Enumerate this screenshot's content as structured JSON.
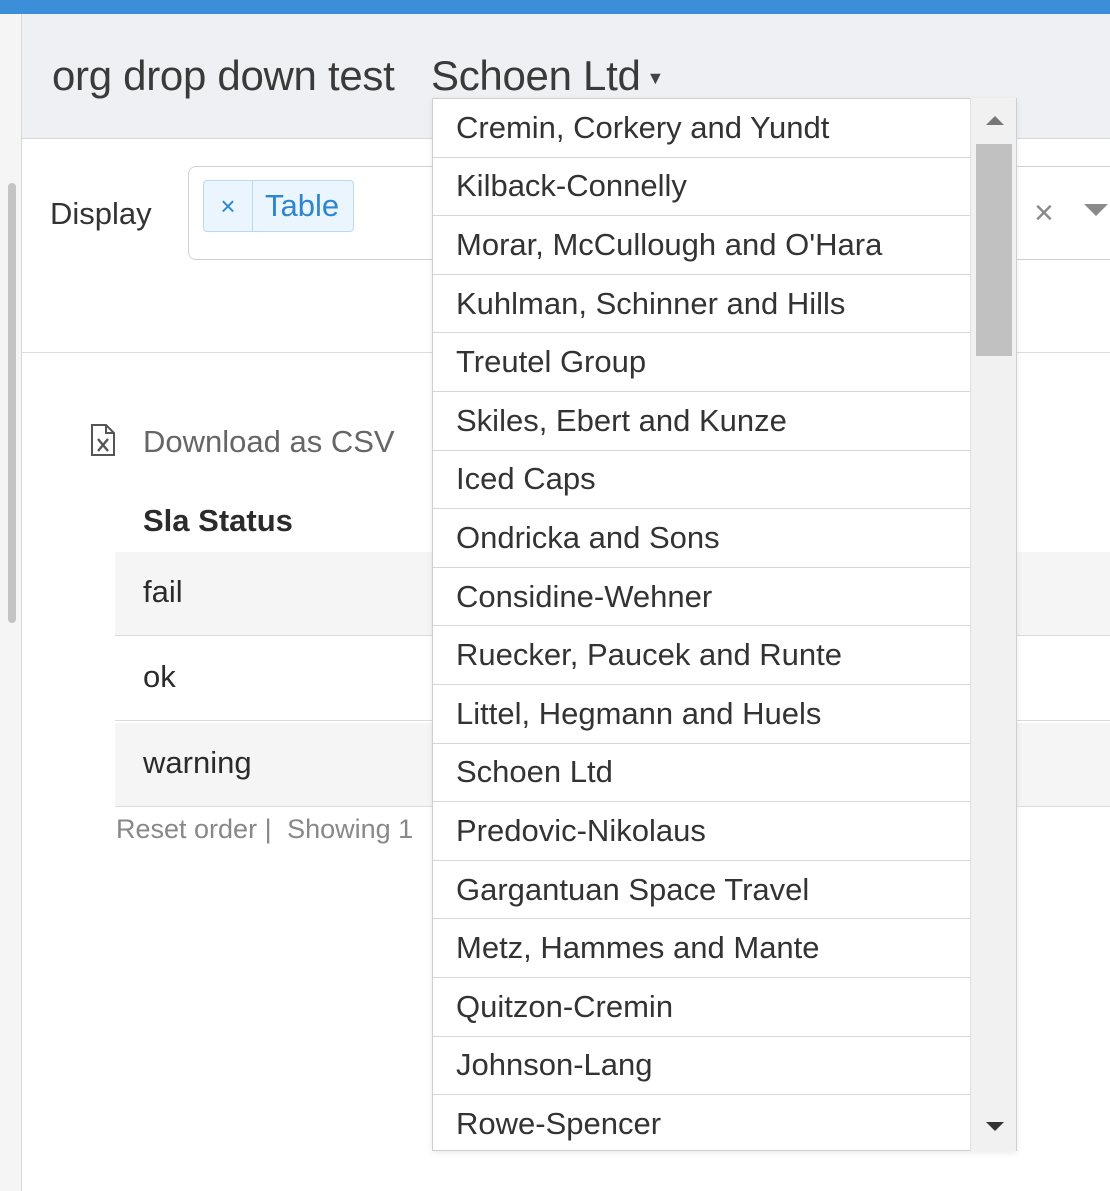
{
  "header": {
    "title": "org drop down test",
    "org_selected": "Schoen Ltd"
  },
  "display": {
    "label": "Display",
    "tag_remove": "×",
    "tag_label": "Table",
    "clear": "×"
  },
  "content": {
    "download_label": "Download as CSV",
    "table_header": "Sla Status",
    "rows": [
      "fail",
      "ok",
      "warning"
    ],
    "footer_reset": "Reset order |",
    "footer_showing": "Showing 1"
  },
  "dropdown": {
    "options": [
      "Cremin, Corkery and Yundt",
      "Kilback-Connelly",
      "Morar, McCullough and O'Hara",
      "Kuhlman, Schinner and Hills",
      "Treutel Group",
      "Skiles, Ebert and Kunze",
      "Iced Caps",
      "Ondricka and Sons",
      "Considine-Wehner",
      "Ruecker, Paucek and Runte",
      "Littel, Hegmann and Huels",
      "Schoen Ltd",
      "Predovic-Nikolaus",
      "Gargantuan Space Travel",
      "Metz, Hammes and Mante",
      "Quitzon-Cremin",
      "Johnson-Lang",
      "Rowe-Spencer"
    ]
  },
  "colors": {
    "accent": "#3b8fd8",
    "tag_background": "#eaf5fd",
    "tag_text": "#2e86cf"
  }
}
